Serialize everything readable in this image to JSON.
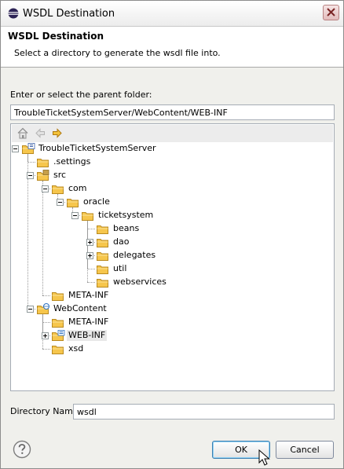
{
  "window": {
    "title": "WSDL Destination",
    "icon": "eclipse-icon"
  },
  "banner": {
    "title": "WSDL Destination",
    "description": "Select a directory to generate the wsdl file into."
  },
  "parent_folder": {
    "label": "Enter or select the parent folder:",
    "value": "TroubleTicketSystemServer/WebContent/WEB-INF"
  },
  "tree_toolbar": {
    "icons": [
      "home-icon",
      "back-icon",
      "forward-icon"
    ]
  },
  "tree": {
    "items": [
      {
        "label": "TroubleTicketSystemServer",
        "icon": "project-icon",
        "expander": "open"
      },
      {
        "label": ".settings",
        "icon": "folder-icon",
        "expander": "none"
      },
      {
        "label": "src",
        "icon": "source-folder-icon",
        "expander": "open"
      },
      {
        "label": "com",
        "icon": "folder-icon",
        "expander": "open"
      },
      {
        "label": "oracle",
        "icon": "folder-icon",
        "expander": "open"
      },
      {
        "label": "ticketsystem",
        "icon": "folder-icon",
        "expander": "open"
      },
      {
        "label": "beans",
        "icon": "folder-icon",
        "expander": "none"
      },
      {
        "label": "dao",
        "icon": "folder-icon",
        "expander": "closed"
      },
      {
        "label": "delegates",
        "icon": "folder-icon",
        "expander": "closed"
      },
      {
        "label": "util",
        "icon": "folder-icon",
        "expander": "none"
      },
      {
        "label": "webservices",
        "icon": "folder-icon",
        "expander": "none"
      },
      {
        "label": "META-INF",
        "icon": "folder-icon",
        "expander": "none"
      },
      {
        "label": "WebContent",
        "icon": "web-content-icon",
        "expander": "open"
      },
      {
        "label": "META-INF",
        "icon": "folder-icon",
        "expander": "none"
      },
      {
        "label": "WEB-INF",
        "icon": "web-inf-icon",
        "expander": "closed",
        "selected": true
      },
      {
        "label": "xsd",
        "icon": "folder-icon",
        "expander": "none"
      }
    ]
  },
  "directory_name": {
    "label": "Directory Name",
    "value": "wsdl"
  },
  "buttons": {
    "ok": "OK",
    "cancel": "Cancel",
    "help_icon": "help-icon"
  },
  "colors": {
    "dialog_bg": "#f0f0ec",
    "folder": "#f6c64c",
    "default_button_border": "#3c7fb1"
  }
}
